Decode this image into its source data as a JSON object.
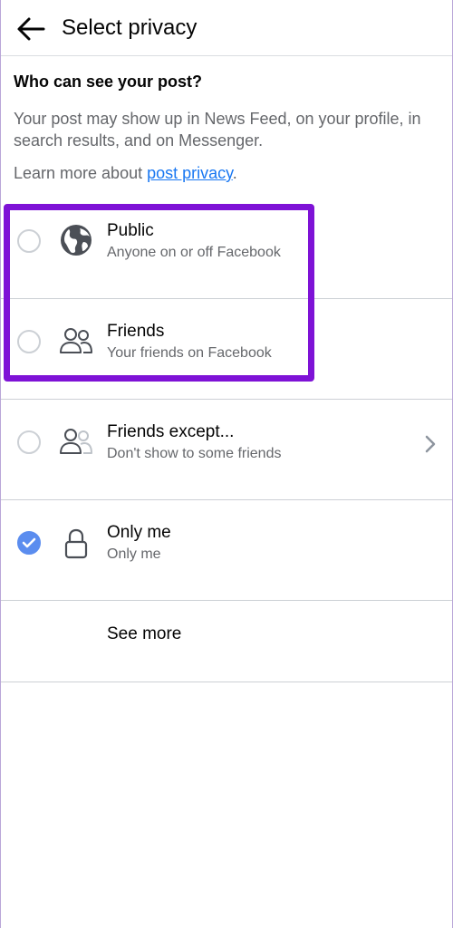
{
  "header": {
    "title": "Select privacy",
    "back_icon": "arrow-left-icon"
  },
  "intro": {
    "heading": "Who can see your post?",
    "description": "Your post may show up in News Feed, on your profile, in search results, and on Messenger.",
    "learn_more_prefix": "Learn more about ",
    "learn_more_link": "post privacy",
    "learn_more_suffix": "."
  },
  "options": [
    {
      "title": "Public",
      "subtitle": "Anyone on or off Facebook",
      "icon": "globe-icon",
      "selected": false
    },
    {
      "title": "Friends",
      "subtitle": "Your friends on Facebook",
      "icon": "friends-icon",
      "selected": false
    },
    {
      "title": "Friends except...",
      "subtitle": "Don't show to some friends",
      "icon": "friends-except-icon",
      "selected": false,
      "has_chevron": true
    },
    {
      "title": "Only me",
      "subtitle": "Only me",
      "icon": "lock-icon",
      "selected": true
    }
  ],
  "see_more": {
    "label": "See more"
  },
  "colors": {
    "link": "#1877f2",
    "selected_radio": "#5b8def",
    "highlight": "#7e12d6",
    "secondary_text": "#65676b"
  }
}
